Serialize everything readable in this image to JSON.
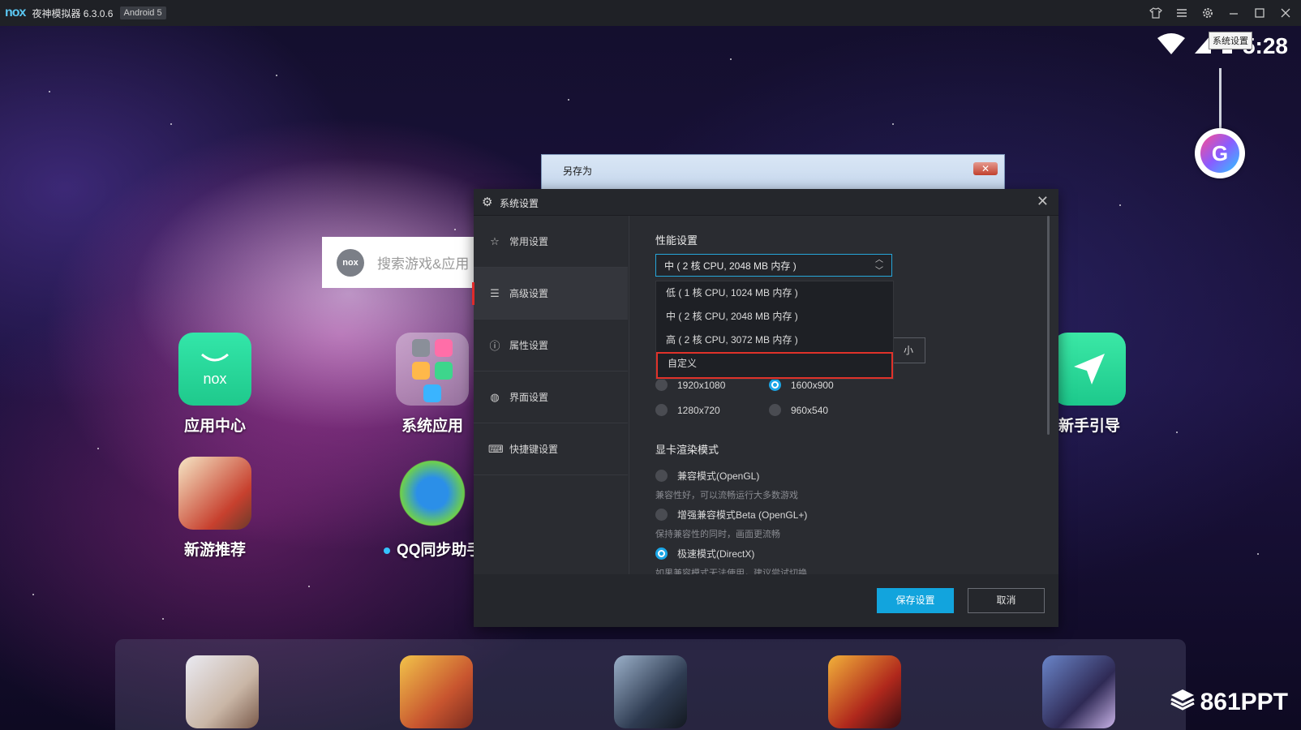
{
  "titlebar": {
    "logo": "nox",
    "title": "夜神模拟器 6.3.0.6",
    "android_badge": "Android 5",
    "controls": [
      "shirt-icon",
      "menu-icon",
      "gear-icon",
      "minimize-icon",
      "maximize-icon",
      "close-icon"
    ]
  },
  "status": {
    "clock": "5:28",
    "tooltip": "系统设置"
  },
  "search": {
    "placeholder": "搜索游戏&应用",
    "logo": "nox"
  },
  "desktop_icons": [
    {
      "label": "应用中心"
    },
    {
      "label": "系统应用"
    },
    {
      "label": "新手引导"
    },
    {
      "label": "新游推荐"
    },
    {
      "label": "QQ同步助手"
    }
  ],
  "saveas": {
    "title": "另存为"
  },
  "dialog": {
    "title": "系统设置",
    "nav": [
      {
        "label": "常用设置",
        "icon": "star-icon"
      },
      {
        "label": "高级设置",
        "icon": "sliders-icon"
      },
      {
        "label": "属性设置",
        "icon": "info-icon"
      },
      {
        "label": "界面设置",
        "icon": "palette-icon"
      },
      {
        "label": "快捷键设置",
        "icon": "keyboard-icon"
      }
    ],
    "performance": {
      "title": "性能设置",
      "selected": "中 ( 2 核 CPU, 2048 MB 内存 )",
      "options": [
        "低 ( 1 核 CPU, 1024 MB 内存 )",
        "中 ( 2 核 CPU, 2048 MB 内存 )",
        "高 ( 2 核 CPU, 3072 MB 内存 )",
        "自定义"
      ],
      "hidden_button_fragment": "小"
    },
    "resolution": {
      "options": [
        "1920x1080",
        "1600x900",
        "1280x720",
        "960x540"
      ],
      "selected": "1600x900"
    },
    "render": {
      "title": "显卡渲染模式",
      "modes": [
        {
          "label": "兼容模式(OpenGL)",
          "hint": "兼容性好，可以流畅运行大多数游戏"
        },
        {
          "label": "增强兼容模式Beta (OpenGL+)",
          "hint": "保持兼容性的同时，画面更流畅"
        },
        {
          "label": "极速模式(DirectX)",
          "hint": "如果兼容模式无法使用，建议尝试切换"
        }
      ],
      "selected": "极速模式(DirectX)"
    },
    "buttons": {
      "save": "保存设置",
      "cancel": "取消"
    }
  },
  "watermark": "861PPT"
}
